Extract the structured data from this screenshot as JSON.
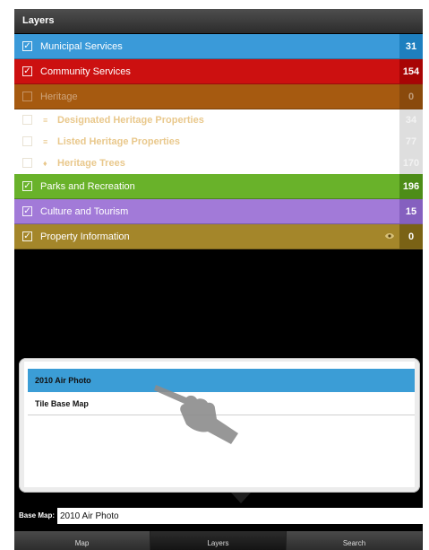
{
  "header": {
    "title": "Layers"
  },
  "layers": [
    {
      "label": "Municipal Services",
      "count": "31",
      "checked": true,
      "bg": "#3a9ad9",
      "countBg": "#1e7fbf"
    },
    {
      "label": "Community Services",
      "count": "154",
      "checked": true,
      "bg": "#cc1010",
      "countBg": "#a80505"
    },
    {
      "label": "Heritage",
      "count": "0",
      "checked": false,
      "bg": "#a65a10",
      "countBg": "#8a4a0c",
      "dim": true
    },
    {
      "label": "Designated Heritage Properties",
      "count": "34",
      "checked": false,
      "sub": true,
      "icon": "≡"
    },
    {
      "label": "Listed Heritage Properties",
      "count": "77",
      "checked": false,
      "sub": true,
      "icon": "≡"
    },
    {
      "label": "Heritage Trees",
      "count": "170",
      "checked": false,
      "sub": true,
      "icon": "♦"
    },
    {
      "label": "Parks and Recreation",
      "count": "196",
      "checked": true,
      "bg": "#69b22a",
      "countBg": "#4d8d18"
    },
    {
      "label": "Culture and Tourism",
      "count": "15",
      "checked": true,
      "bg": "#a27ad8",
      "countBg": "#8560bf"
    },
    {
      "label": "Property Information",
      "count": "0",
      "checked": true,
      "bg": "#a4862a",
      "countBg": "#7a6215",
      "eye": true
    }
  ],
  "basemap_popover": {
    "options": [
      {
        "label": "2010 Air Photo",
        "selected": true
      },
      {
        "label": "Tile Base Map",
        "selected": false
      }
    ]
  },
  "basemap": {
    "label": "Base Map:",
    "value": "2010 Air Photo"
  },
  "tabs": [
    {
      "label": "Map",
      "active": false
    },
    {
      "label": "Layers",
      "active": true
    },
    {
      "label": "Search",
      "active": false
    }
  ]
}
